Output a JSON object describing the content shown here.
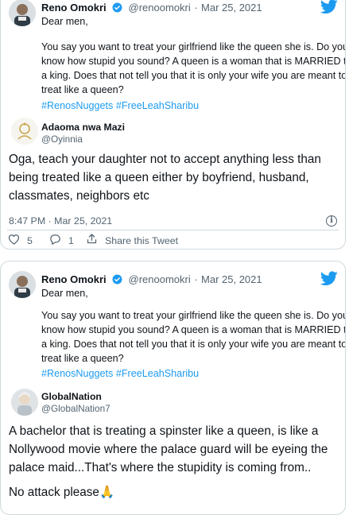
{
  "tweets": [
    {
      "author_name": "Reno Omokri",
      "author_handle": "@renoomokri",
      "separator": "·",
      "date": "Mar 25, 2021",
      "greeting": "Dear men,",
      "body_lines": [
        "You say you want to treat your girlfriend like the queen she is. Do you",
        "know how stupid you sound? A queen is a woman that is MARRIED to",
        "a king. Does that not tell you that it is only your wife you are meant to",
        "treat like a queen?"
      ],
      "hashtags": "#RenosNuggets #FreeLeahSharibu",
      "reply": {
        "name": "Adaoma nwa Mazi",
        "handle": "@Oyinnia",
        "text_lines": [
          "Oga, teach your daughter not to accept anything less than",
          "being treated like a queen either by boyfriend, husband,",
          "classmates, neighbors etc"
        ]
      },
      "timestamp": "8:47 PM · Mar 25, 2021",
      "info_glyph": "i",
      "likes": "5",
      "replies": "1",
      "share_label": "Share this Tweet"
    },
    {
      "author_name": "Reno Omokri",
      "author_handle": "@renoomokri",
      "separator": "·",
      "date": "Mar 25, 2021",
      "greeting": "Dear men,",
      "body_lines": [
        "You say you want to treat your girlfriend like the queen she is. Do you",
        "know how stupid you sound? A queen is a woman that is MARRIED to",
        "a king. Does that not tell you that it is only your wife you are meant to",
        "treat like a queen?"
      ],
      "hashtags": "#RenosNuggets #FreeLeahSharibu",
      "reply": {
        "name": "GlobalNation",
        "handle": "@GlobalNation7",
        "text_lines": [
          "A bachelor that is treating a spinster like a queen, is like a",
          "Nollywood movie where the palace guard will be eyeing the",
          "palace maid...That's where the stupidity is coming from.."
        ],
        "text_extra": "No attack please",
        "emoji": "🙏"
      }
    }
  ],
  "colors": {
    "twitter_blue": "#1d9bf0",
    "text": "#0f1419",
    "secondary": "#536471",
    "border": "#cfd9de"
  },
  "icons": {
    "logo": "twitter-bird-icon",
    "verified": "verified-badge-icon",
    "like": "heart-icon",
    "reply": "reply-bubble-icon",
    "share": "share-upload-icon",
    "info": "info-icon"
  }
}
